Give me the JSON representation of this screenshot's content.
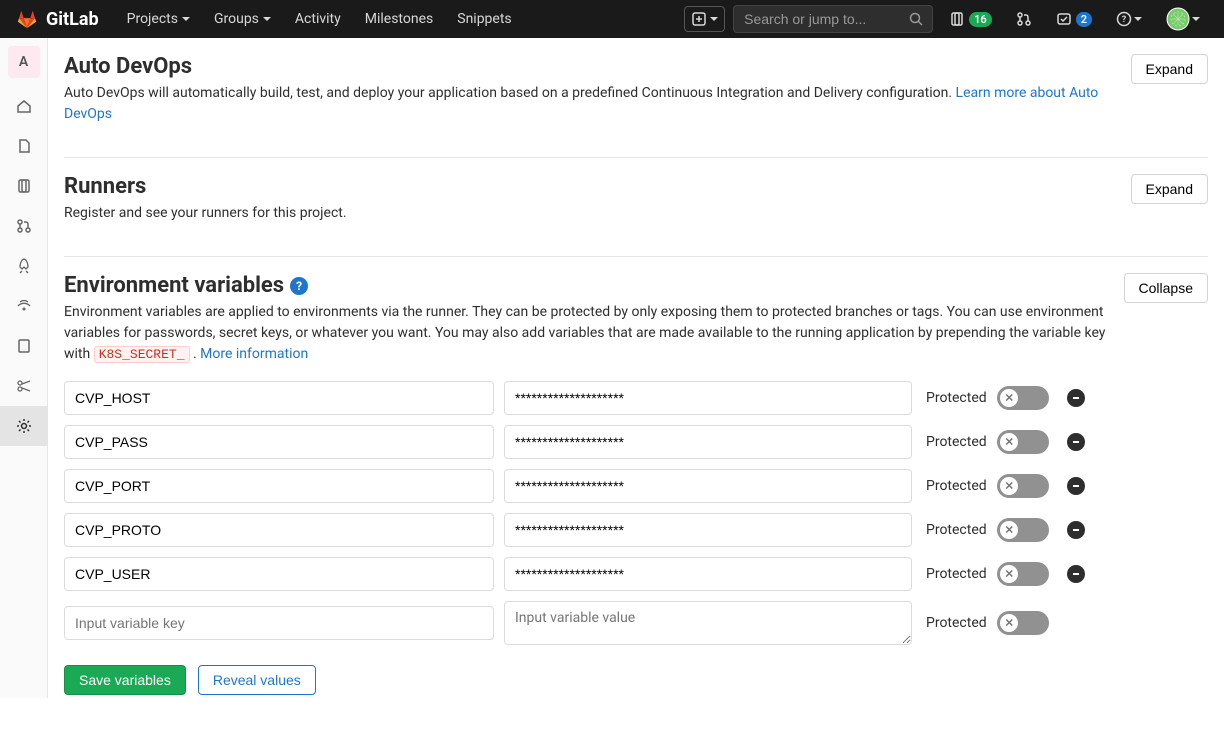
{
  "navbar": {
    "brand": "GitLab",
    "nav": [
      {
        "label": "Projects",
        "hasDropdown": true
      },
      {
        "label": "Groups",
        "hasDropdown": true
      },
      {
        "label": "Activity",
        "hasDropdown": false
      },
      {
        "label": "Milestones",
        "hasDropdown": false
      },
      {
        "label": "Snippets",
        "hasDropdown": false
      }
    ],
    "search_placeholder": "Search or jump to...",
    "issues_badge": "16",
    "todos_badge": "2"
  },
  "sidebar": {
    "project_letter": "A"
  },
  "sections": {
    "autodevops": {
      "title": "Auto DevOps",
      "desc": "Auto DevOps will automatically build, test, and deploy your application based on a predefined Continuous Integration and Delivery configuration. ",
      "link": "Learn more about Auto DevOps",
      "button": "Expand"
    },
    "runners": {
      "title": "Runners",
      "desc": "Register and see your runners for this project.",
      "button": "Expand"
    },
    "envvars": {
      "title": "Environment variables",
      "desc": "Environment variables are applied to environments via the runner. They can be protected by only exposing them to protected branches or tags. You can use environment variables for passwords, secret keys, or whatever you want. You may also add variables that are made available to the running application by prepending the variable key with ",
      "code": "K8S_SECRET_",
      "more_link": "More information",
      "button": "Collapse",
      "protected_label": "Protected",
      "vars": [
        {
          "key": "CVP_HOST",
          "value": "********************"
        },
        {
          "key": "CVP_PASS",
          "value": "********************"
        },
        {
          "key": "CVP_PORT",
          "value": "********************"
        },
        {
          "key": "CVP_PROTO",
          "value": "********************"
        },
        {
          "key": "CVP_USER",
          "value": "********************"
        }
      ],
      "new_key_placeholder": "Input variable key",
      "new_value_placeholder": "Input variable value",
      "save_btn": "Save variables",
      "reveal_btn": "Reveal values"
    }
  }
}
